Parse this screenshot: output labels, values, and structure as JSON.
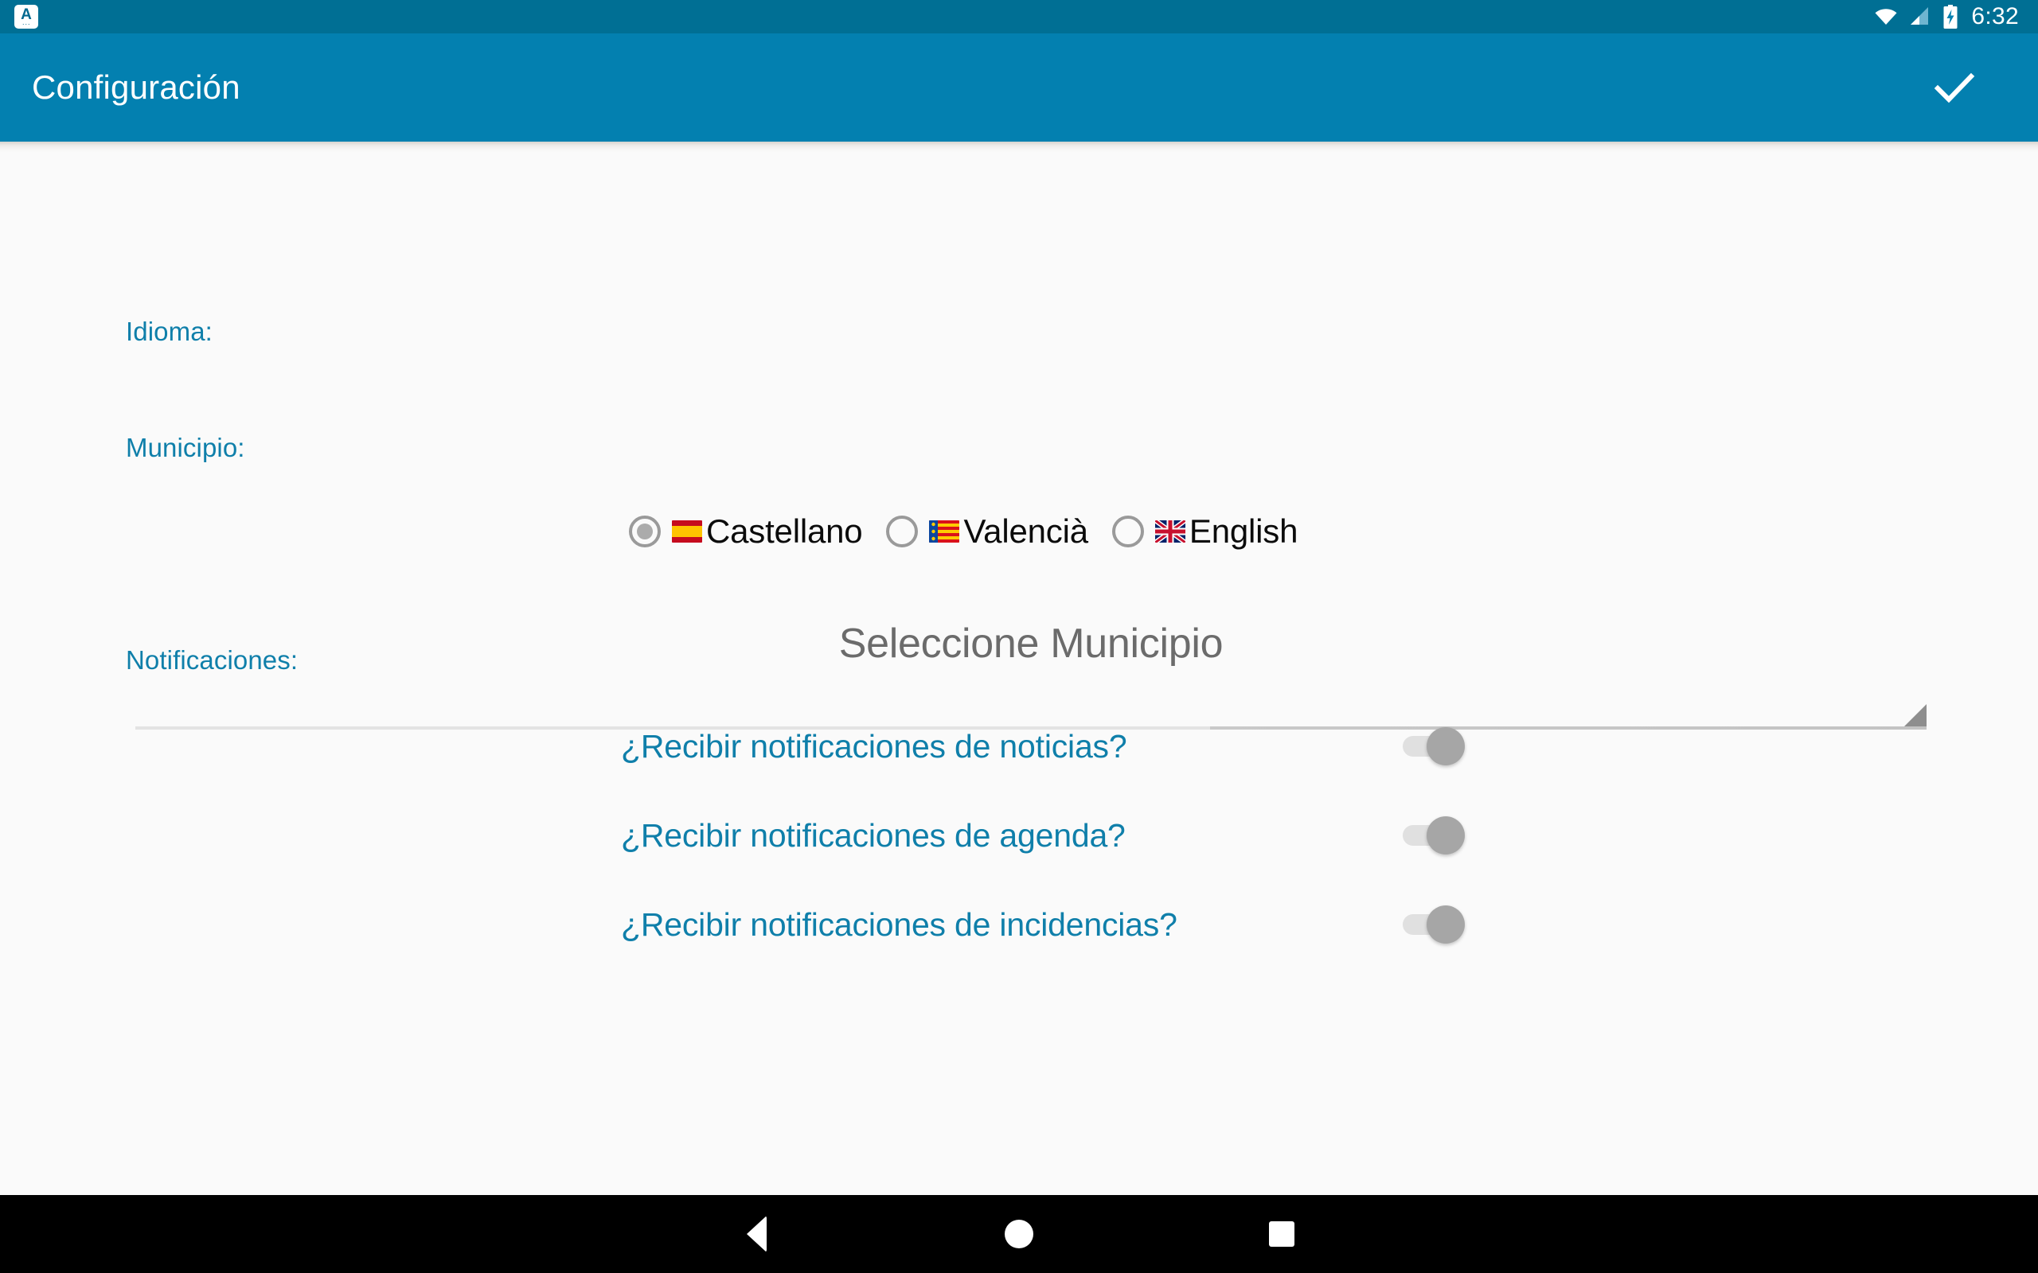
{
  "status_bar": {
    "app_icon": "app-notification-icon",
    "icons": [
      "wifi-icon",
      "cell-signal-icon",
      "battery-charging-icon"
    ],
    "app_icon_glyph": "A",
    "app_icon_dots": "···",
    "time": "6:32"
  },
  "app_bar": {
    "title": "Configuración",
    "action_icon": "check-icon",
    "background_color": "#0380b0"
  },
  "content": {
    "labels": {
      "idioma": "Idioma:",
      "municipio": "Municipio:",
      "notificaciones": "Notificaciones:"
    },
    "label_color": "#0f7faa",
    "language": {
      "selected": "Castellano",
      "options": [
        {
          "label": "Castellano",
          "flag": "flag-spain",
          "checked": true
        },
        {
          "label": "Valencià",
          "flag": "flag-valencia",
          "checked": false
        },
        {
          "label": "English",
          "flag": "flag-united-kingdom",
          "checked": false
        }
      ]
    },
    "municipio": {
      "value": "Seleccione Municipio",
      "placeholder": "Seleccione Municipio",
      "caret_icon": "dropdown-caret-icon"
    },
    "notifications": [
      {
        "label": "¿Recibir notificaciones de noticias?",
        "enabled": false
      },
      {
        "label": "¿Recibir notificaciones de agenda?",
        "enabled": false
      },
      {
        "label": "¿Recibir notificaciones de incidencias?",
        "enabled": false
      }
    ]
  },
  "nav_bar": {
    "buttons": [
      {
        "name": "back",
        "icon": "triangle-back-icon"
      },
      {
        "name": "home",
        "icon": "circle-home-icon"
      },
      {
        "name": "recents",
        "icon": "square-recents-icon"
      }
    ]
  }
}
